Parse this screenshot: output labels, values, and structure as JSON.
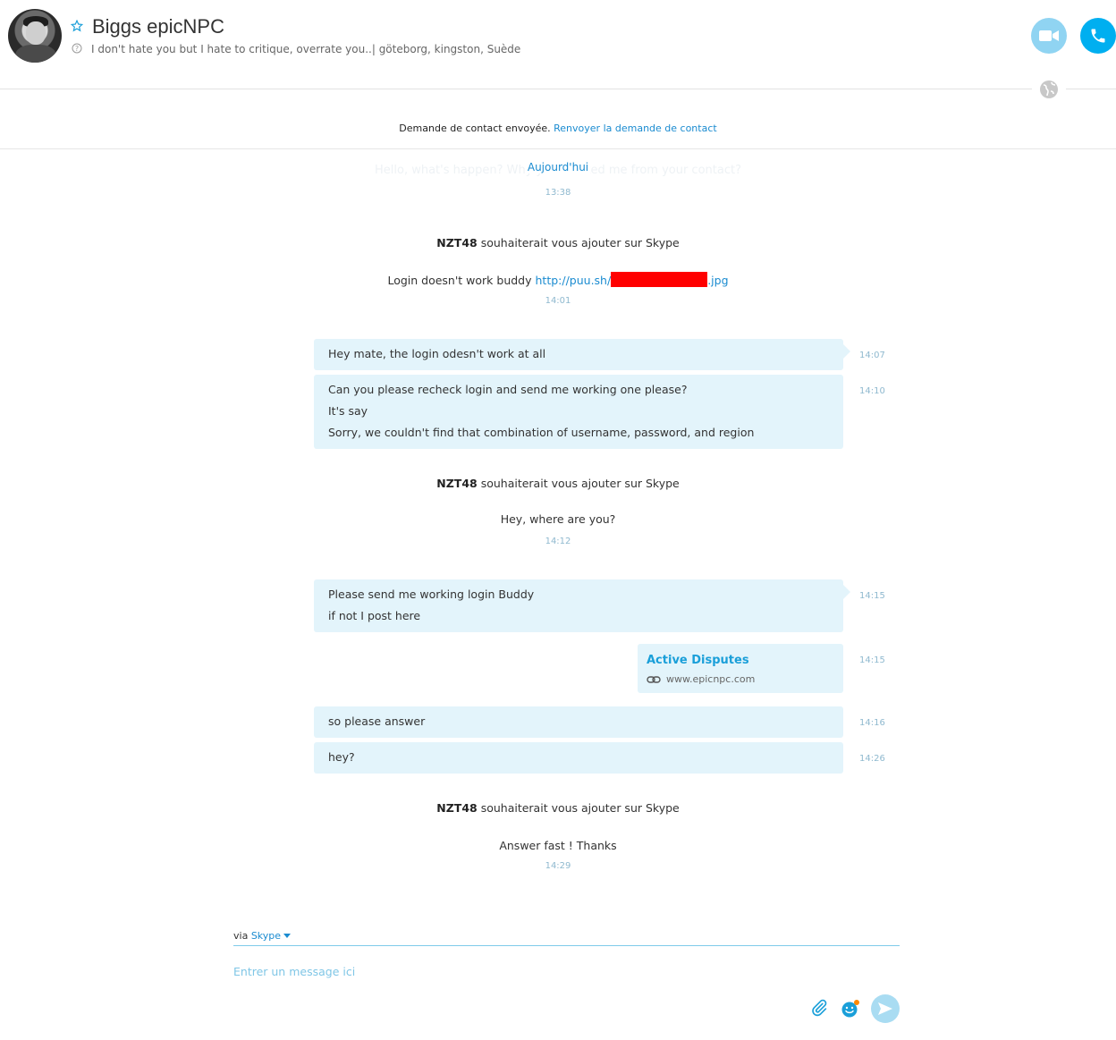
{
  "header": {
    "contact_name": "Biggs epicNPC",
    "mood": "I don't hate you but I hate to critique, overrate you..|  göteborg, kingston, Suède",
    "video_call_icon": "video-camera-icon",
    "audio_call_icon": "phone-icon"
  },
  "notice": {
    "text": "Demande de contact envoyée.",
    "link": "Renvoyer la demande de contact"
  },
  "conversation": {
    "ghost_text": "Hello, what's happen? Why you deleted me from your contact?",
    "date_separator": "Aujourd'hui",
    "time_1": "13:38",
    "sys_1_user": "NZT48",
    "sys_1_text": " souhaiterait vous ajouter sur Skype",
    "msg_1_text": "Login doesn't work buddy  ",
    "msg_1_link_start": "http://puu.sh/",
    "msg_1_link_end": ".jpg",
    "time_2": "14:01",
    "bubble_1": {
      "text": "Hey mate, the login odesn't work at all",
      "time": "14:07"
    },
    "bubble_2": {
      "lines": [
        "Can you please recheck login and send me working one please?",
        "It's say",
        "Sorry, we couldn't find that combination of username, password, and region"
      ],
      "time": "14:10"
    },
    "sys_2_user": "NZT48",
    "sys_2_text": " souhaiterait vous ajouter sur Skype",
    "msg_2_text": "Hey, where are you?",
    "time_3": "14:12",
    "bubble_3": {
      "lines": [
        "Please send me working login Buddy",
        "if not I post here"
      ],
      "time": "14:15"
    },
    "card": {
      "title": "Active Disputes",
      "url": "www.epicnpc.com",
      "time": "14:15"
    },
    "bubble_4": {
      "text": "so please answer",
      "time": "14:16"
    },
    "bubble_5": {
      "text": "hey?",
      "time": "14:26"
    },
    "sys_3_user": "NZT48",
    "sys_3_text": " souhaiterait vous ajouter sur Skype",
    "msg_3_text": "Answer fast ! Thanks",
    "time_4": "14:29"
  },
  "composer": {
    "via_label": "via ",
    "service": "Skype",
    "placeholder": "Entrer un message ici",
    "value": ""
  },
  "colors": {
    "accent": "#00aff0",
    "bubble": "#e3f4fb",
    "link": "#1a8bd0",
    "redaction": "#ff0000"
  }
}
